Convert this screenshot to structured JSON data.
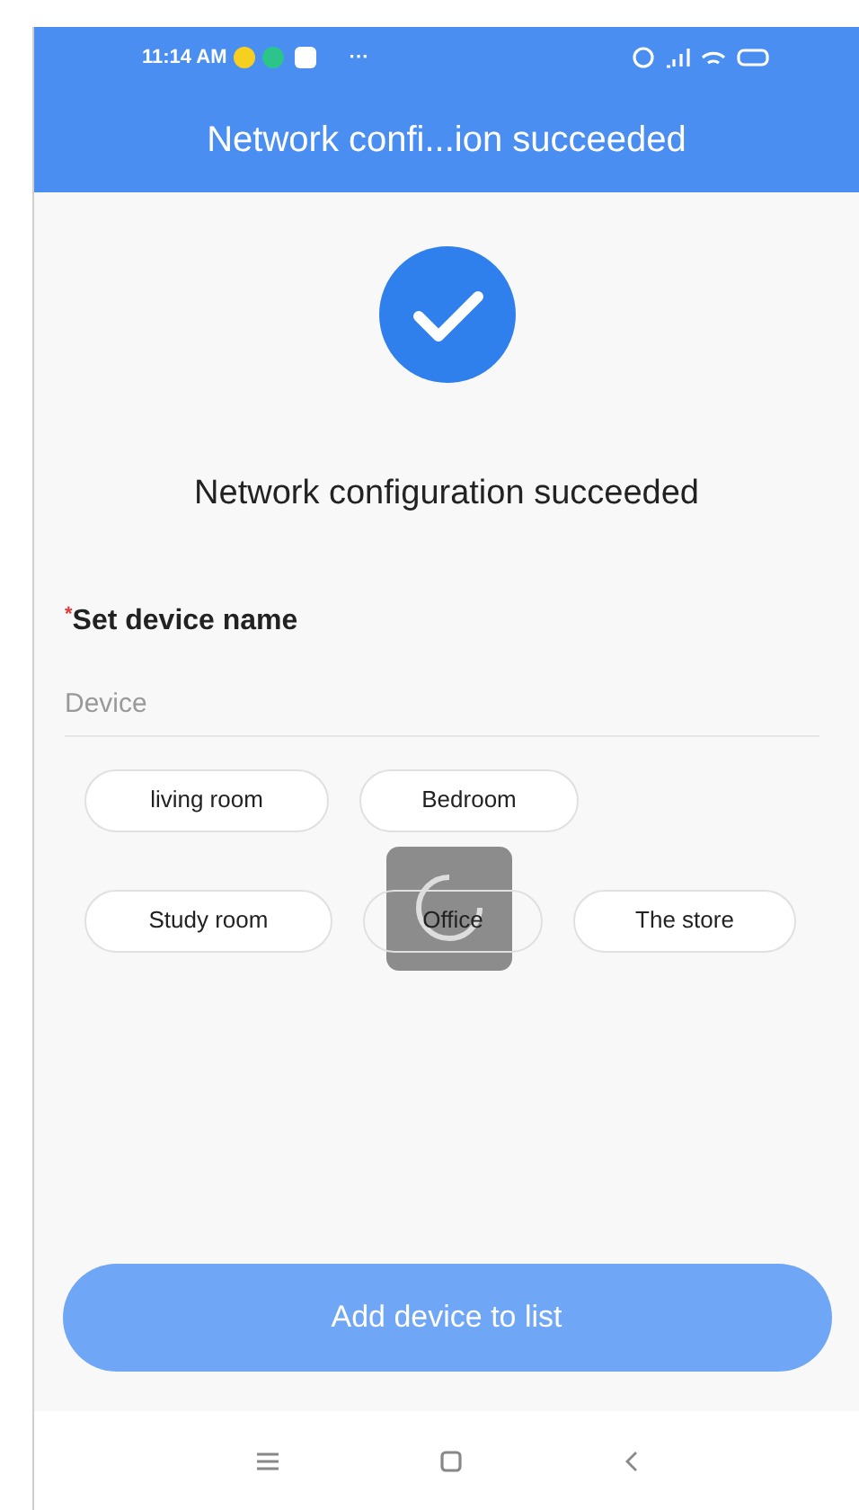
{
  "status_bar": {
    "time": "11:14 AM",
    "more": "···"
  },
  "title_bar": {
    "title": "Network confi...ion succeeded"
  },
  "result": {
    "message": "Network configuration succeeded"
  },
  "device_name": {
    "label": "Set device name",
    "required": true,
    "required_mark": "*",
    "placeholder": "Device"
  },
  "chips": [
    {
      "label": "living room"
    },
    {
      "label": "Bedroom"
    },
    {
      "label": "Study room"
    },
    {
      "label": "Office"
    },
    {
      "label": "The store"
    }
  ],
  "loading": true,
  "primary_button": {
    "label": "Add device to list",
    "disabled": true
  }
}
